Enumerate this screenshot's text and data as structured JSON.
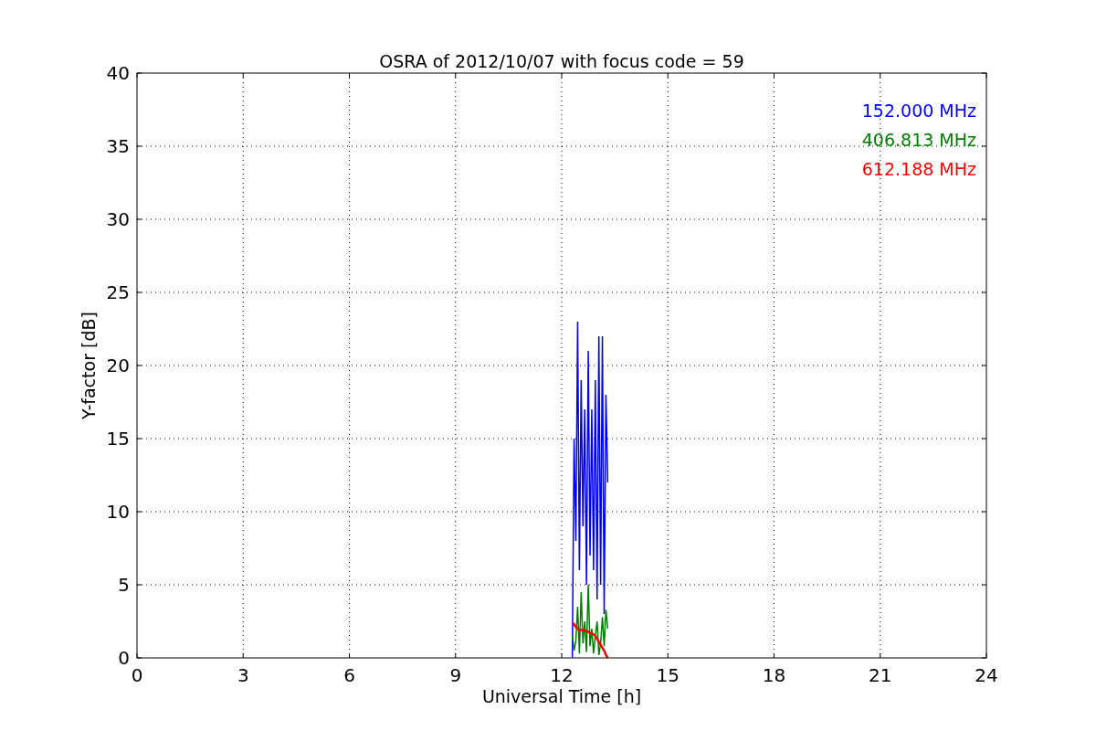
{
  "figure": {
    "chart_data": {
      "type": "line",
      "title": "OSRA of 2012/10/07 with focus code = 59",
      "xlabel": "Universal Time [h]",
      "ylabel": "Y-factor [dB]",
      "x": [
        12.3,
        12.35,
        12.4,
        12.45,
        12.5,
        12.55,
        12.6,
        12.65,
        12.7,
        12.75,
        12.8,
        12.85,
        12.9,
        12.95,
        13.0,
        13.05,
        13.1,
        13.15,
        13.2,
        13.25,
        13.3
      ],
      "series": [
        {
          "name": "152.000 MHz",
          "color": "#0000ff",
          "values": [
            0,
            15,
            8,
            23,
            6,
            19,
            9,
            17,
            5,
            21,
            7,
            17,
            6,
            19,
            4,
            22,
            5,
            22,
            3,
            18,
            12
          ]
        },
        {
          "name": "406.813 MHz",
          "color": "#008000",
          "values": [
            1.5,
            0.5,
            1.2,
            3.5,
            0.3,
            4.5,
            1,
            2.5,
            0.4,
            5,
            0.8,
            2,
            0.3,
            1.5,
            2.5,
            0.2,
            1,
            2.8,
            0.8,
            3.3,
            2
          ]
        },
        {
          "name": "612.188 MHz",
          "color": "#ff0000",
          "values": [
            2.4,
            2.3,
            2.1,
            2,
            1.9,
            1.9,
            1.9,
            1.9,
            1.8,
            1.8,
            1.7,
            1.7,
            1.6,
            1.5,
            1.3,
            1.1,
            0.9,
            0.7,
            0.5,
            0.2,
            0
          ]
        }
      ],
      "grid": true,
      "xlim": [
        0,
        24
      ],
      "ylim": [
        0,
        40
      ],
      "xticks": [
        0,
        3,
        6,
        9,
        12,
        15,
        18,
        21,
        24
      ],
      "yticks": [
        0,
        5,
        10,
        15,
        20,
        25,
        30,
        35,
        40
      ]
    }
  }
}
